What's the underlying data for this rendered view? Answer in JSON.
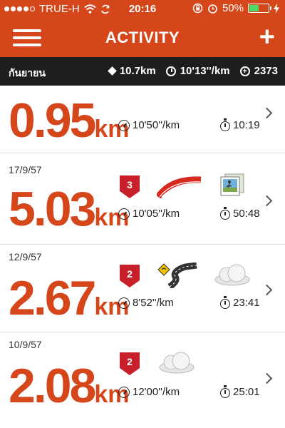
{
  "status_bar": {
    "carrier": "TRUE-H",
    "time": "20:16",
    "battery_percent": "50%",
    "battery_level": 0.5,
    "signal_bars_filled": 4
  },
  "nav": {
    "title": "ACTIVITY",
    "add_label": "+"
  },
  "summary": {
    "month": "กันยายน",
    "total_distance": "10.7km",
    "avg_pace": "10'13''/km",
    "total_fuel": "2373"
  },
  "runs": [
    {
      "date": "",
      "distance": "0.95",
      "unit": "km",
      "pace": "10'50''/km",
      "duration": "10:19",
      "badge": "",
      "icons": []
    },
    {
      "date": "17/9/57",
      "distance": "5.03",
      "unit": "km",
      "pace": "10'05''/km",
      "duration": "50:48",
      "badge": "3",
      "icons": [
        "track-icon",
        "photo-icon"
      ]
    },
    {
      "date": "12/9/57",
      "distance": "2.67",
      "unit": "km",
      "pace": "8'52''/km",
      "duration": "23:41",
      "badge": "2",
      "icons": [
        "road-icon",
        "cloud-icon"
      ]
    },
    {
      "date": "10/9/57",
      "distance": "2.08",
      "unit": "km",
      "pace": "12'00''/km",
      "duration": "25:01",
      "badge": "2",
      "icons": [
        "cloud-icon"
      ]
    }
  ],
  "colors": {
    "accent": "#d5461b",
    "summary_bg": "#1e1e1e",
    "battery": "#4cd964"
  }
}
